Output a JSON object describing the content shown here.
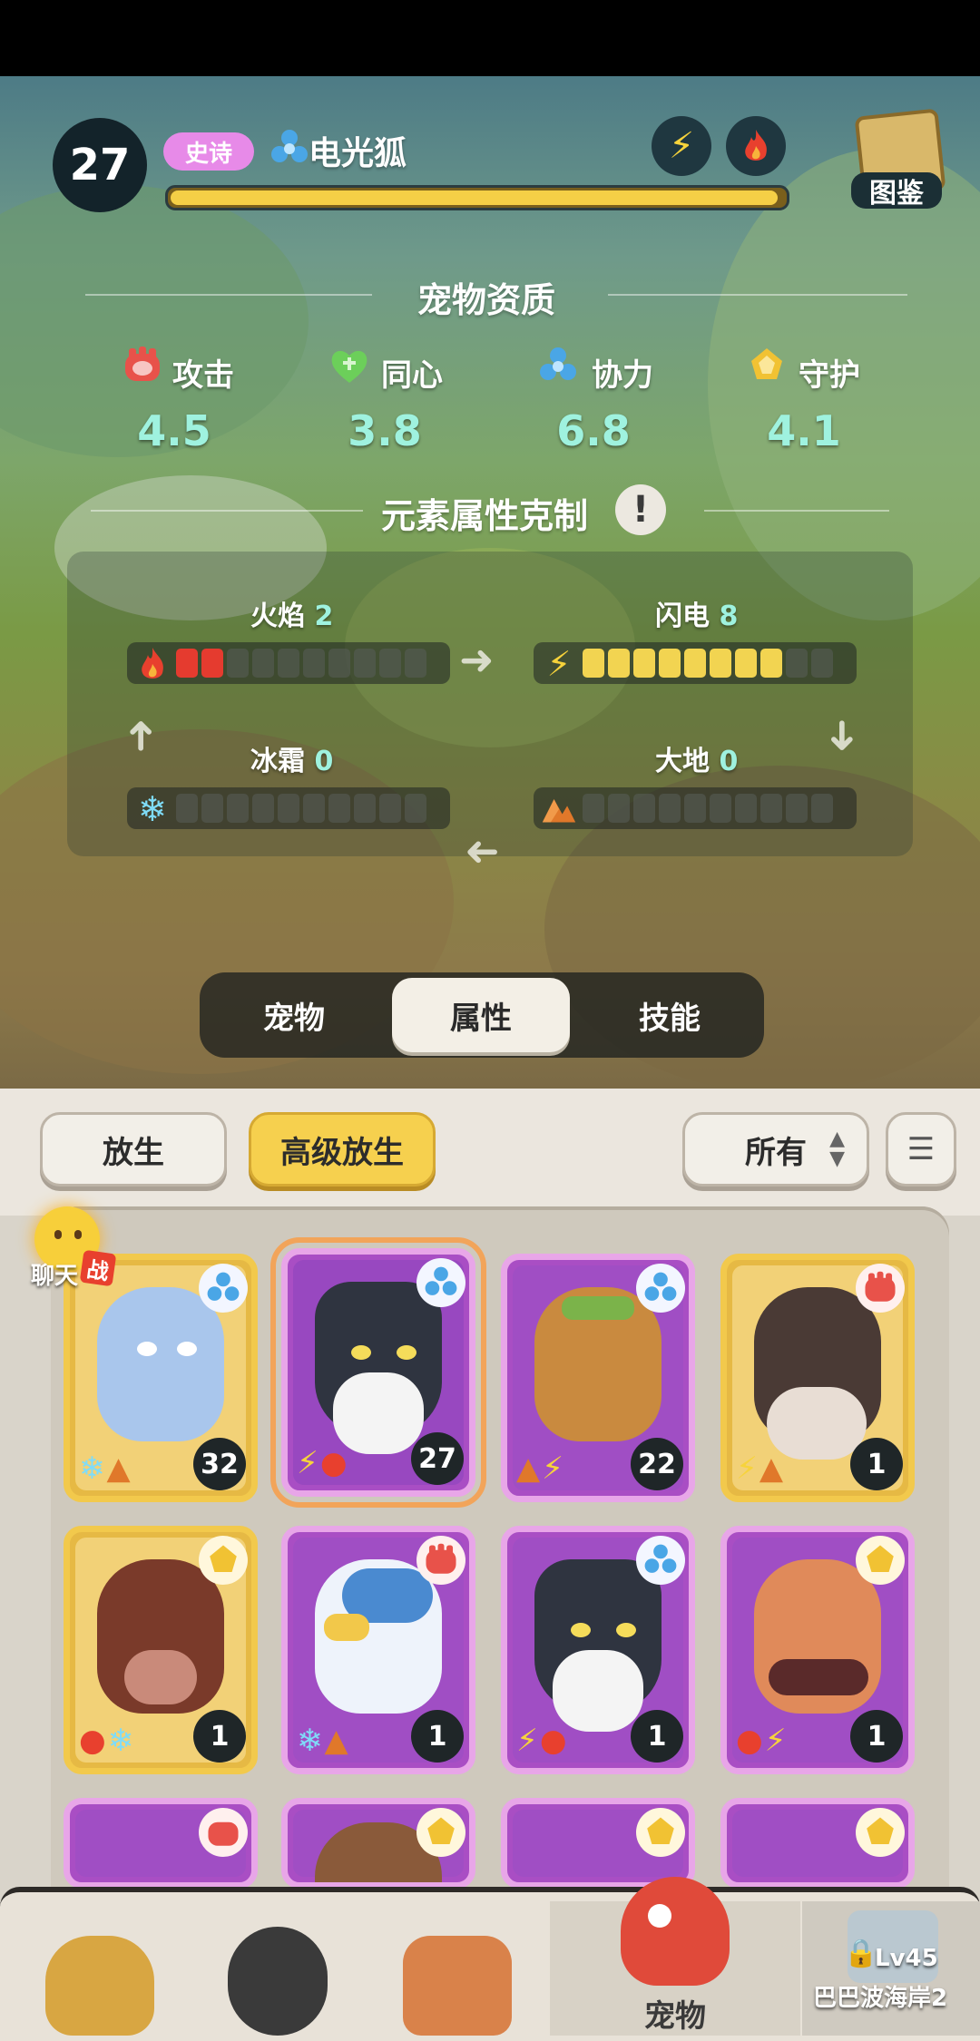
{
  "header": {
    "level": "27",
    "rarity": "史诗",
    "pet_name": "电光狐",
    "xp_fraction": 0.99,
    "illustrated_handbook": "图鉴",
    "element_icons": [
      "lightning-icon",
      "fire-icon"
    ]
  },
  "aptitude": {
    "title": "宠物资质",
    "stats": [
      {
        "label": "攻击",
        "value": "4.5",
        "icon": "attack-icon"
      },
      {
        "label": "同心",
        "value": "3.8",
        "icon": "heart-icon"
      },
      {
        "label": "协力",
        "value": "6.8",
        "icon": "cooperation-icon"
      },
      {
        "label": "守护",
        "value": "4.1",
        "icon": "guard-icon"
      }
    ]
  },
  "elements": {
    "title": "元素属性克制",
    "info_icon": "exclamation-icon",
    "items": [
      {
        "name": "火焰",
        "value": "2",
        "filled": 2,
        "total": 10,
        "color": "#e53b2f"
      },
      {
        "name": "闪电",
        "value": "8",
        "filled": 8,
        "total": 10,
        "color": "#f2d451"
      },
      {
        "name": "冰霜",
        "value": "0",
        "filled": 0,
        "total": 10,
        "color": "#6fd6f5"
      },
      {
        "name": "大地",
        "value": "0",
        "filled": 0,
        "total": 10,
        "color": "#e0782a"
      }
    ]
  },
  "tabs": [
    {
      "label": "宠物",
      "active": false
    },
    {
      "label": "属性",
      "active": true
    },
    {
      "label": "技能",
      "active": false
    }
  ],
  "toolbar": {
    "release": "放生",
    "advanced_release": "高级放生",
    "filter": "所有"
  },
  "chat": {
    "label": "聊天",
    "badge": "战"
  },
  "cards": [
    {
      "level": "32",
      "frame": "gold",
      "role": "cooperation",
      "elements": [
        "❄",
        "▲"
      ]
    },
    {
      "level": "27",
      "frame": "pink",
      "role": "cooperation",
      "elements": [
        "⚡",
        "🔥"
      ],
      "selected": true
    },
    {
      "level": "22",
      "frame": "pink",
      "role": "cooperation",
      "elements": [
        "▲",
        "⚡"
      ]
    },
    {
      "level": "1",
      "frame": "gold",
      "role": "attack",
      "elements": [
        "⚡",
        "▲"
      ]
    },
    {
      "level": "1",
      "frame": "gold",
      "role": "guard",
      "elements": [
        "🔥",
        "❄"
      ]
    },
    {
      "level": "1",
      "frame": "pink",
      "role": "attack",
      "elements": [
        "❄",
        "▲"
      ]
    },
    {
      "level": "1",
      "frame": "pink",
      "role": "cooperation",
      "elements": [
        "⚡",
        "🔥"
      ]
    },
    {
      "level": "1",
      "frame": "pink",
      "role": "guard",
      "elements": [
        "🔥",
        "⚡"
      ]
    }
  ],
  "nav": {
    "active_label": "宠物",
    "locked_level": "Lv45",
    "locked_place": "巴巴波海岸2"
  }
}
